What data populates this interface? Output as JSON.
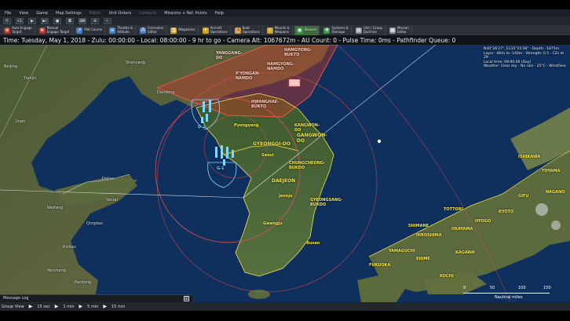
{
  "menu": {
    "items": [
      {
        "label": "File",
        "enabled": true
      },
      {
        "label": "View",
        "enabled": true
      },
      {
        "label": "Game",
        "enabled": true
      },
      {
        "label": "Map Settings",
        "enabled": true
      },
      {
        "label": "Editor",
        "enabled": false
      },
      {
        "label": "Unit Orders",
        "enabled": true
      },
      {
        "label": "Contacts",
        "enabled": false
      },
      {
        "label": "Missions + Ref. Points",
        "enabled": true
      },
      {
        "label": "Help",
        "enabled": true
      }
    ]
  },
  "toolbar_top": {
    "buttons": [
      {
        "icon": "refresh-icon",
        "text": "⟳"
      },
      {
        "icon": "speed-icon",
        "text": "x1"
      },
      {
        "icon": "play-icon",
        "text": "▶"
      },
      {
        "icon": "step-icon",
        "text": "▶|"
      },
      {
        "icon": "record-icon",
        "text": "●"
      },
      {
        "icon": "camera-icon",
        "text": "◘"
      },
      {
        "icon": "keyboard-icon",
        "text": "⌨"
      },
      {
        "icon": "zoom-icon",
        "text": "⊕"
      },
      {
        "icon": "pointer-icon",
        "text": "↖"
      }
    ]
  },
  "toolbar_main": {
    "buttons": [
      {
        "icon": "crosshair-icon",
        "label": "Auto Engage\nTarget",
        "color": "#b03a2e",
        "glyph": "⊕"
      },
      {
        "icon": "target-icon",
        "label": "Manual\nEngage Target",
        "color": "#b03a2e",
        "glyph": "⊗"
      },
      {
        "icon": "course-icon",
        "label": "Plot Course",
        "color": "#4a7fc1",
        "glyph": "↗"
      },
      {
        "icon": "throttle-icon",
        "label": "Throttle &\nAltitude",
        "color": "#4a7fc1",
        "glyph": "≡"
      },
      {
        "icon": "formation-icon",
        "label": "Formation\nEditor",
        "color": "#4a7fc1",
        "glyph": "⁂"
      },
      {
        "icon": "magazine-icon",
        "label": "Magazines",
        "color": "#c9a227",
        "glyph": "▥"
      },
      {
        "icon": "aircraft-icon",
        "label": "Aircraft\nOperations",
        "color": "#c9a227",
        "glyph": "✈"
      },
      {
        "icon": "boat-icon",
        "label": "Boat\nOperations",
        "color": "#c9a227",
        "glyph": "⛵"
      },
      {
        "icon": "mounts-icon",
        "label": "Mounts &\nWeapons",
        "color": "#c9a227",
        "glyph": "⚔"
      },
      {
        "icon": "sensor-icon",
        "label": "Sensors",
        "color": "#3a9a4a",
        "glyph": "◉",
        "active": true
      },
      {
        "icon": "damage-icon",
        "label": "Systems &\nDamage",
        "color": "#3a9a4a",
        "glyph": "✚"
      },
      {
        "icon": "doctrine-icon",
        "label": "Unit / Group\nDoctrine",
        "color": "#8a8f96",
        "glyph": "▤"
      },
      {
        "icon": "mission-editor-icon",
        "label": "Mission\nEditor",
        "color": "#8a8f96",
        "glyph": "▦"
      }
    ]
  },
  "status": {
    "text": "Time: Tuesday, May 1, 2018 - Zulu: 00:00:00 - Local: 08:00:00 - 9 hr to go -  Camera Alt: 1067672m  - AU Count: 0 - Pulse Time: 0ms - Pathfinder Queue: 0"
  },
  "cursor_info": {
    "line1": "N40°26'27\", E135°25'36\" - Depth: -1875m",
    "line2": "Layer: -86m to -140m - Strength: 0.5 - CZs at 29",
    "line3": "Local time: 09:00:00 (Day)",
    "line4": "Weather: Clear sky - No rain - 25°C - Wind/Sea"
  },
  "map_labels": {
    "korea_regions": [
      {
        "text": "YANGGANG-\nDO",
        "size": "small"
      },
      {
        "text": "HAMGYONG-\nBUKTO",
        "size": "small"
      },
      {
        "text": "HAMGYONG-\nNAMDO",
        "size": "small"
      },
      {
        "text": "P'YONGAN-\nNAMDO",
        "size": "small"
      },
      {
        "text": "HWANGHAE-\nBUKTO",
        "size": "small"
      },
      {
        "text": "KANGWON-\nDO",
        "size": "small"
      },
      {
        "text": "GANGWON-\nDO",
        "size": "big"
      },
      {
        "text": "GYEONGGI-DO",
        "size": "big"
      },
      {
        "text": "CHUNGCHEONG-\nBUKDO",
        "size": "small"
      },
      {
        "text": "DAEJEON",
        "size": "big"
      },
      {
        "text": "GYEONGSANG-\nBUKDO",
        "size": "small"
      },
      {
        "text": "Seoul",
        "size": "small"
      },
      {
        "text": "Pyongyang",
        "size": "small"
      },
      {
        "text": "Busan",
        "size": "small"
      },
      {
        "text": "Jeonju",
        "size": "small"
      },
      {
        "text": "Gwangju",
        "size": "small"
      }
    ],
    "japan_regions": [
      {
        "text": "TOTTORI",
        "size": "small"
      },
      {
        "text": "SHIMANE",
        "size": "small"
      },
      {
        "text": "FUKUOKA",
        "size": "small"
      },
      {
        "text": "HIROSHIMA",
        "size": "small"
      },
      {
        "text": "OKAYAMA",
        "size": "small"
      },
      {
        "text": "HYOGO",
        "size": "small"
      },
      {
        "text": "KYOTO",
        "size": "small"
      },
      {
        "text": "KOCHI",
        "size": "small"
      },
      {
        "text": "EHIME",
        "size": "small"
      },
      {
        "text": "KAGAWA",
        "size": "small"
      },
      {
        "text": "ISHIKAWA",
        "size": "small"
      },
      {
        "text": "TOYAMA",
        "size": "small"
      },
      {
        "text": "NAGANO",
        "size": "small"
      },
      {
        "text": "GIFU",
        "size": "small"
      },
      {
        "text": "YAMAGUCHI",
        "size": "small"
      }
    ],
    "china_labels": [
      {
        "text": "Dalian",
        "size": "small"
      },
      {
        "text": "Qingdao",
        "size": "small"
      },
      {
        "text": "Tianjin",
        "size": "small"
      },
      {
        "text": "Weifang",
        "size": "small"
      },
      {
        "text": "Yantai",
        "size": "small"
      },
      {
        "text": "Shenyang",
        "size": "small"
      },
      {
        "text": "Dandong",
        "size": "small"
      },
      {
        "text": "Jinan",
        "size": "small"
      },
      {
        "text": "Beijing",
        "size": "small"
      },
      {
        "text": "Rizhao",
        "size": "small"
      },
      {
        "text": "Yancheng",
        "size": "small"
      },
      {
        "text": "Nantong",
        "size": "small"
      }
    ]
  },
  "unit_labels": {
    "group_label": "G-1",
    "group_label2": "D-2"
  },
  "scale_bar": {
    "ticks": [
      "0",
      "50",
      "100",
      "150"
    ],
    "unit": "Nautical miles"
  },
  "message_log": {
    "label": "Message Log",
    "expand_glyph": "⊞"
  },
  "time_compression": {
    "label": "Group View",
    "steps": [
      {
        "glyph": "▶",
        "text": "15 sec"
      },
      {
        "glyph": "▶",
        "text": "1 min"
      },
      {
        "glyph": "▶",
        "text": "5 min"
      },
      {
        "glyph": "▶",
        "text": "15 min"
      }
    ]
  },
  "colors": {
    "sam_zone": "#c0392b",
    "range_ring": "#e05050",
    "border": "#f2e44c",
    "units": "#7fd8ff",
    "sea": "#0f2a55"
  }
}
